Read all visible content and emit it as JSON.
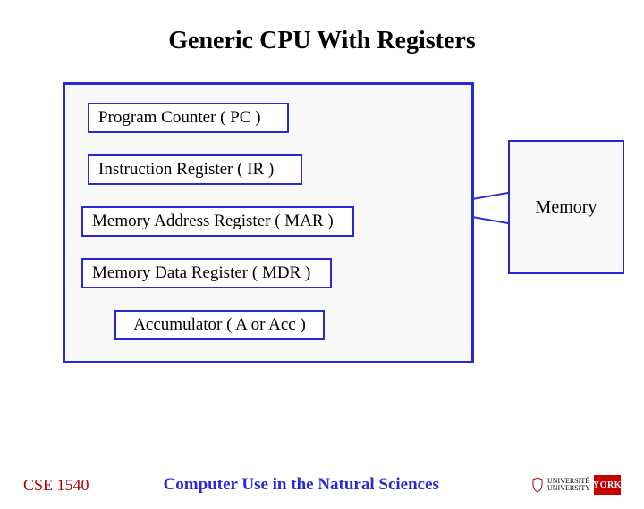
{
  "title": "Generic CPU With Registers",
  "cpu": {
    "registers": {
      "pc": "Program Counter  ( PC )",
      "ir": "Instruction Register  ( IR )",
      "mar": "Memory Address Register  ( MAR )",
      "mdr": "Memory Data Register  ( MDR )",
      "acc": "Accumulator  ( A or Acc )"
    }
  },
  "memory": {
    "label": "Memory"
  },
  "footer": {
    "course": "CSE 1540",
    "subtitle": "Computer Use in the Natural Sciences",
    "logo": {
      "name": "YORK",
      "tag": "UNIVERSITÉ\nUNIVERSITY"
    }
  }
}
